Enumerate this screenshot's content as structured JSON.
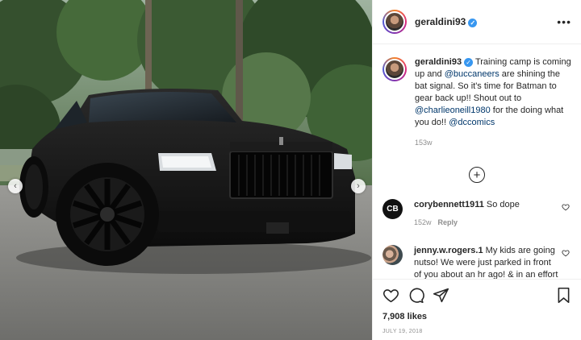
{
  "post": {
    "username": "geraldini93",
    "verified": true,
    "more_icon": "more-horizontal-icon"
  },
  "caption": {
    "username": "geraldini93",
    "parts": {
      "p1": "Training camp is coming up and ",
      "mention1": "@buccaneers",
      "p2": " are shining the bat signal. So it's time for Batman to gear back up!! Shout out to ",
      "mention2": "@charlieoneill1980",
      "p3": " for the doing what you do!! ",
      "mention3": "@dccomics"
    },
    "time": "153w"
  },
  "comments": [
    {
      "username": "corybennett1911",
      "text": "So dope",
      "time": "152w",
      "reply": "Reply",
      "avatar_text": "CB"
    },
    {
      "username": "jenny.w.rogers.1",
      "text": "My kids are going nutso! We were just parked in front of you about an hr ago! & in an effort to not draw attention",
      "time": "",
      "reply": ""
    }
  ],
  "actions": {
    "likes": "7,908 likes",
    "date": "JULY 19, 2018"
  },
  "colors": {
    "link": "#00376b",
    "verified": "#3897f0",
    "muted": "#8e8e8e"
  }
}
